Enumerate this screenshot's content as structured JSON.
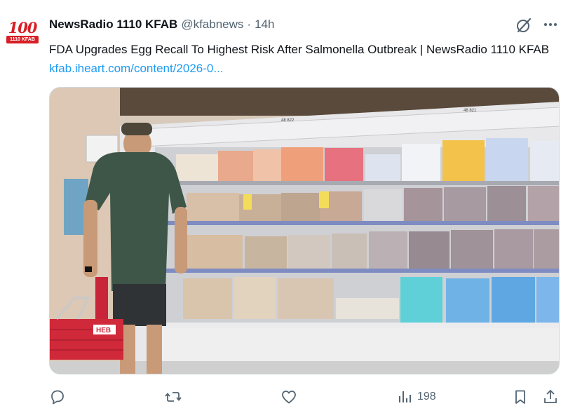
{
  "account": {
    "name": "NewsRadio 1110 KFAB",
    "handle": "@kfabnews",
    "separator": "·",
    "time": "14h",
    "avatar_number": "100",
    "avatar_label": "1110 KFAB"
  },
  "post": {
    "text": "FDA Upgrades Egg Recall To Highest Risk After Salmonella Outbreak | NewsRadio 1110 KFAB ",
    "link": "kfab.iheart.com/content/2026-0..."
  },
  "media": {
    "shelf_tags": [
      "48 822",
      "48 821"
    ],
    "basket_brand": "HEB"
  },
  "actions": {
    "reply_icon": "reply-icon",
    "repost_icon": "repost-icon",
    "like_icon": "heart-icon",
    "views_icon": "views-icon",
    "views_count": "198",
    "bookmark_icon": "bookmark-icon",
    "share_icon": "share-icon"
  },
  "colors": {
    "accent": "#1d9bf0",
    "muted": "#536471",
    "brand_red": "#d71f26"
  }
}
